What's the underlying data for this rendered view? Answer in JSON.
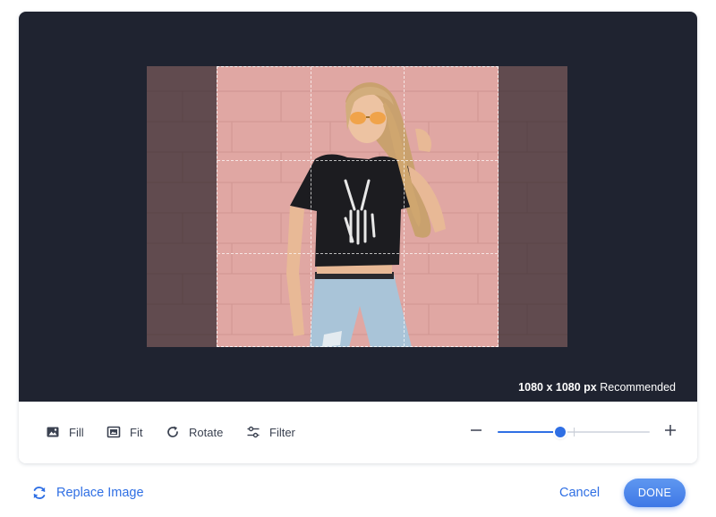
{
  "recommendation": {
    "size": "1080 x 1080 px",
    "suffix": "Recommended"
  },
  "toolbar": {
    "fill_label": "Fill",
    "fit_label": "Fit",
    "rotate_label": "Rotate",
    "filter_label": "Filter",
    "icons": {
      "fill": "image-icon",
      "fit": "fit-icon",
      "rotate": "rotate-icon",
      "filter": "sliders-icon",
      "zoom_out": "minus-icon",
      "zoom_in": "plus-icon"
    }
  },
  "zoom": {
    "level": 0.41
  },
  "footer": {
    "replace_label": "Replace Image",
    "replace_icon": "refresh-icon",
    "cancel_label": "Cancel",
    "done_label": "DONE"
  },
  "colors": {
    "canvas_background": "#1f2330",
    "accent": "#2f6fe4",
    "photo_wall": "#e2a8a4",
    "toolbar_text": "#3a4150"
  }
}
